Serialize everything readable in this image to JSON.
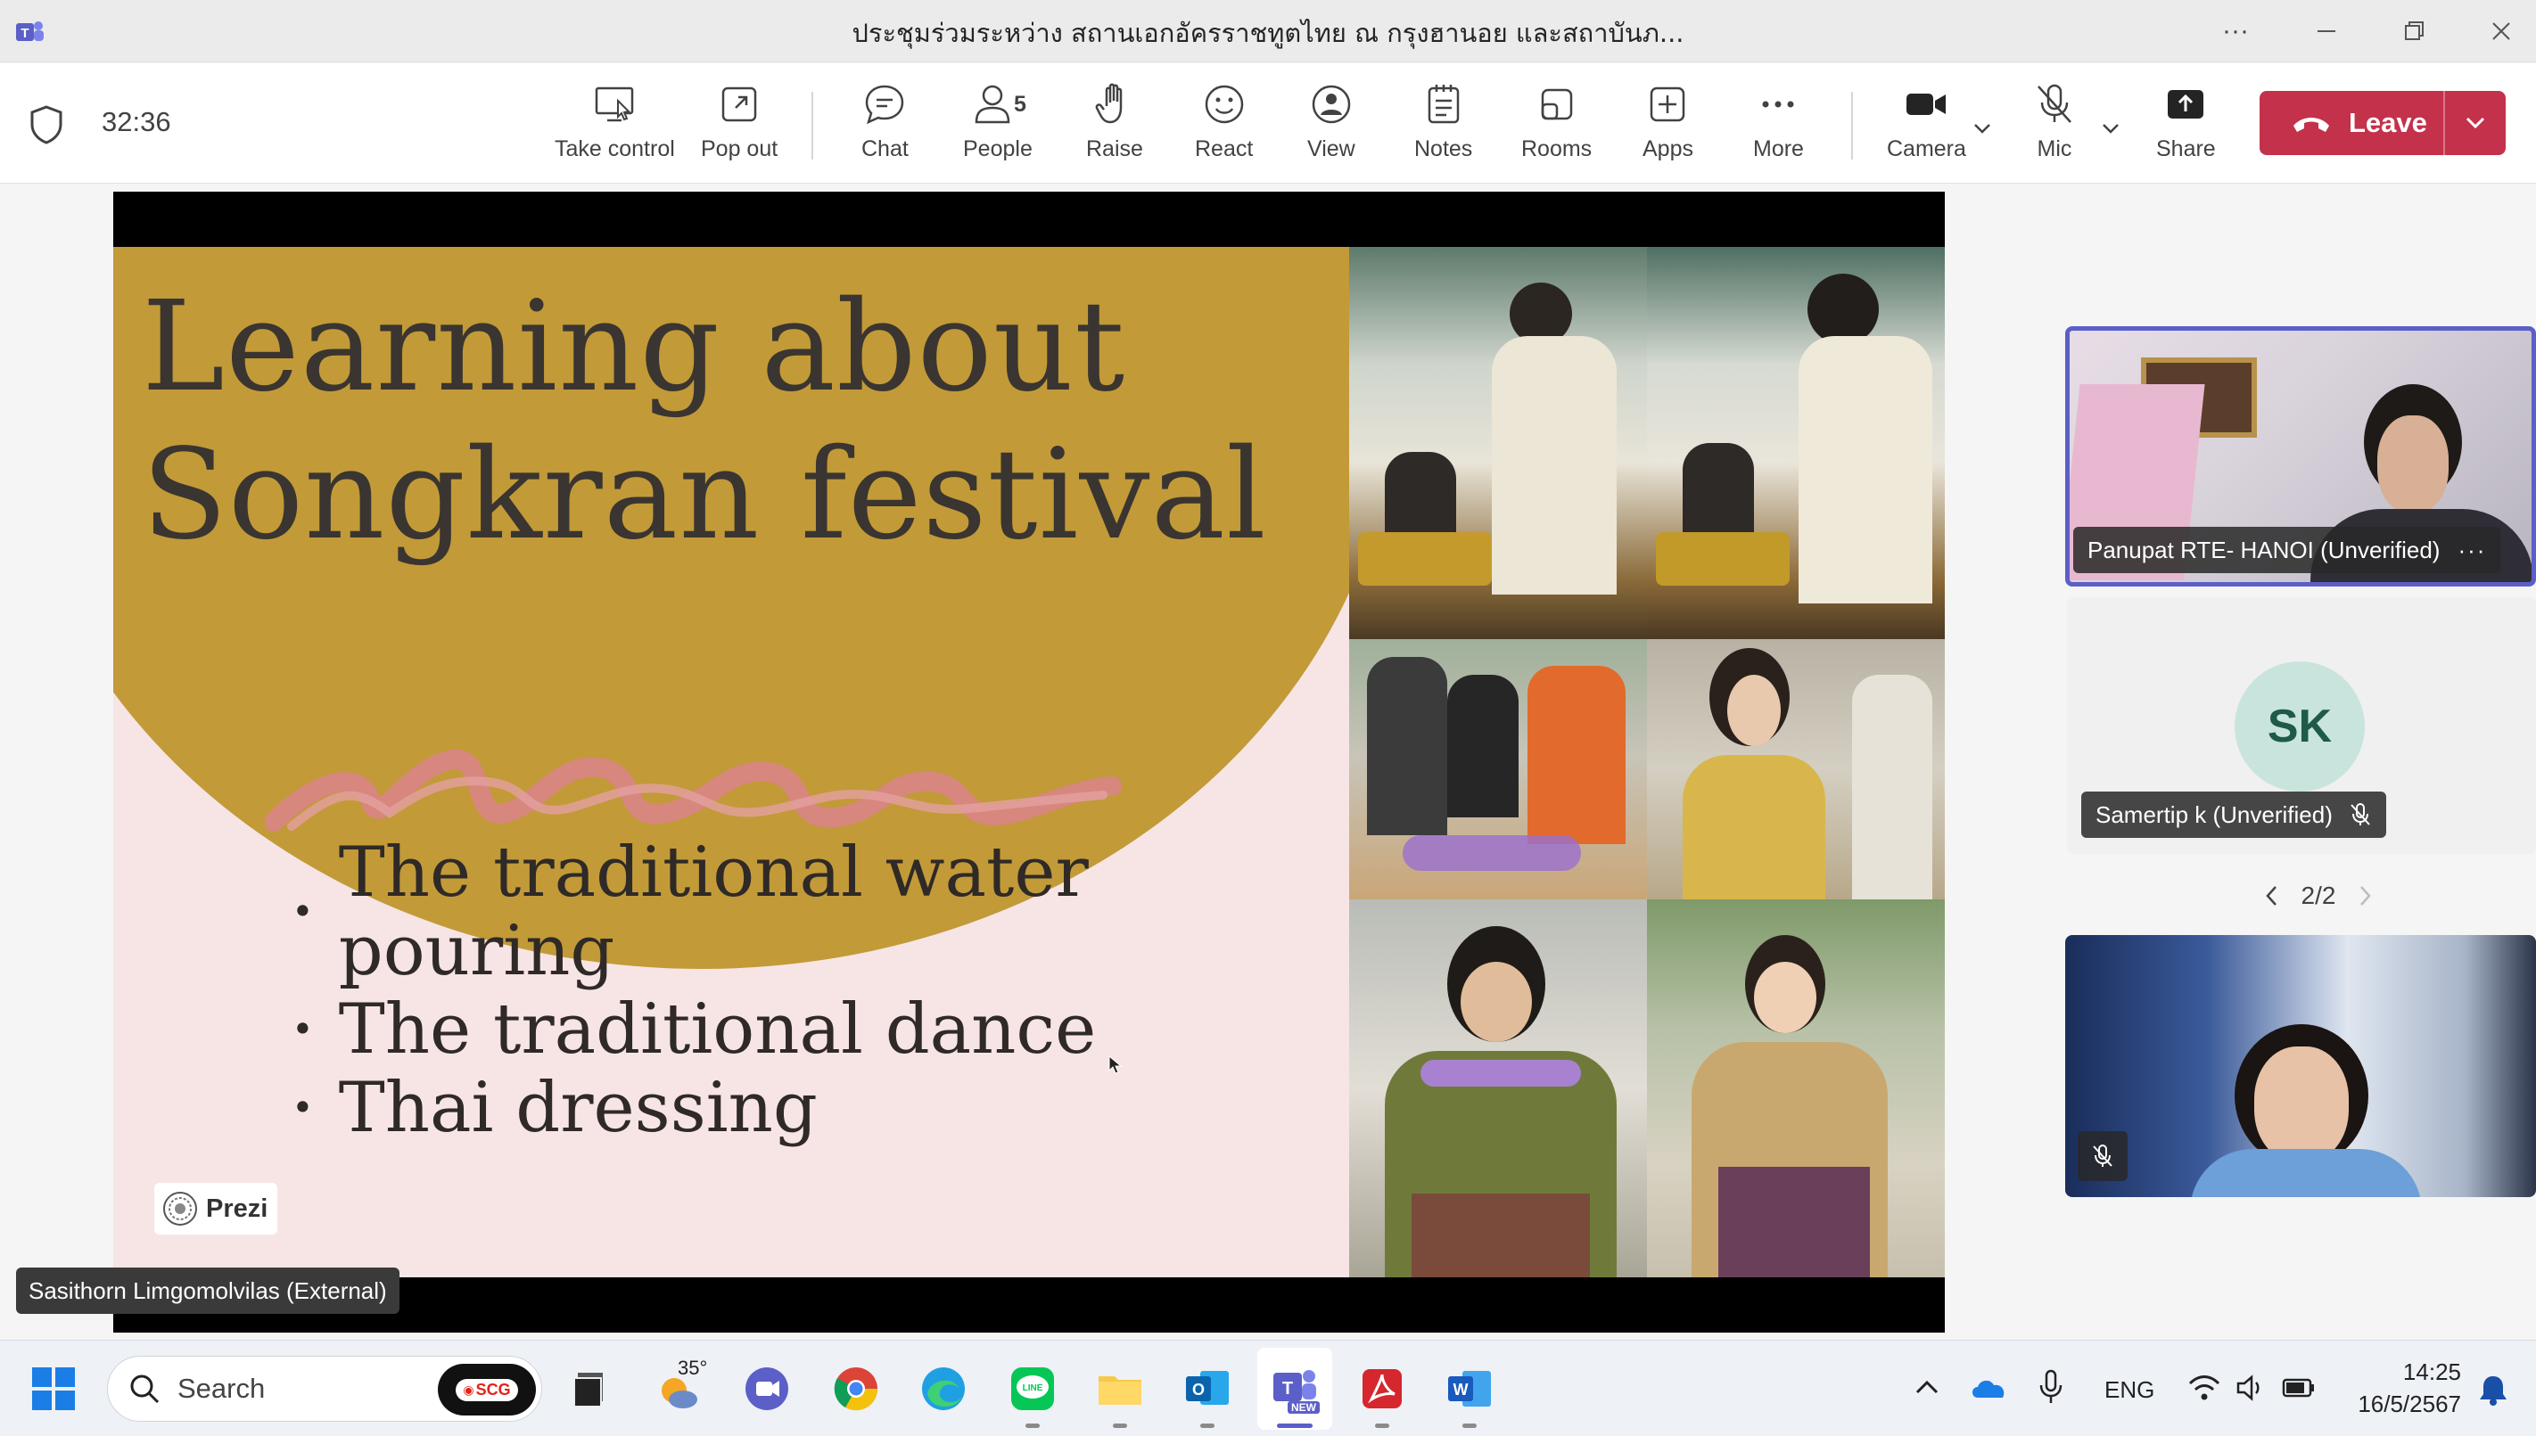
{
  "window": {
    "title": "ประชุมร่วมระหว่าง สถานเอกอัครราชทูตไทย ณ กรุงฮานอย และสถาบันภ..."
  },
  "meeting": {
    "timer": "32:36"
  },
  "toolbar": {
    "take_control": "Take control",
    "pop_out": "Pop out",
    "chat": "Chat",
    "people": "People",
    "people_count": "5",
    "raise": "Raise",
    "react": "React",
    "view": "View",
    "notes": "Notes",
    "rooms": "Rooms",
    "apps": "Apps",
    "more": "More",
    "camera": "Camera",
    "mic": "Mic",
    "share": "Share",
    "leave": "Leave"
  },
  "slide": {
    "title_line1": "Learning about",
    "title_line2": "Songkran festival",
    "bullets": [
      "The traditional water pouring",
      "The traditional dance",
      "Thai dressing"
    ],
    "brand": "Prezi"
  },
  "presenter": {
    "name": "Sasithorn Limgomolvilas (External)"
  },
  "participants": {
    "tile1_name": "Panupat RTE- HANOI (Unverified)",
    "tile2_initials": "SK",
    "tile2_name": "Samertip k (Unverified)",
    "pager": "2/2"
  },
  "taskbar": {
    "search_placeholder": "Search",
    "scg_label": "SCG",
    "weather_temp": "35°",
    "language": "ENG",
    "time": "14:25",
    "date": "16/5/2567",
    "teams_badge": "NEW"
  },
  "colors": {
    "accent": "#5b5fc7",
    "leave_red": "#c4314b",
    "slide_gold": "#c29a38",
    "slide_pink": "#f7e5e5",
    "squiggle": "#d98585"
  }
}
